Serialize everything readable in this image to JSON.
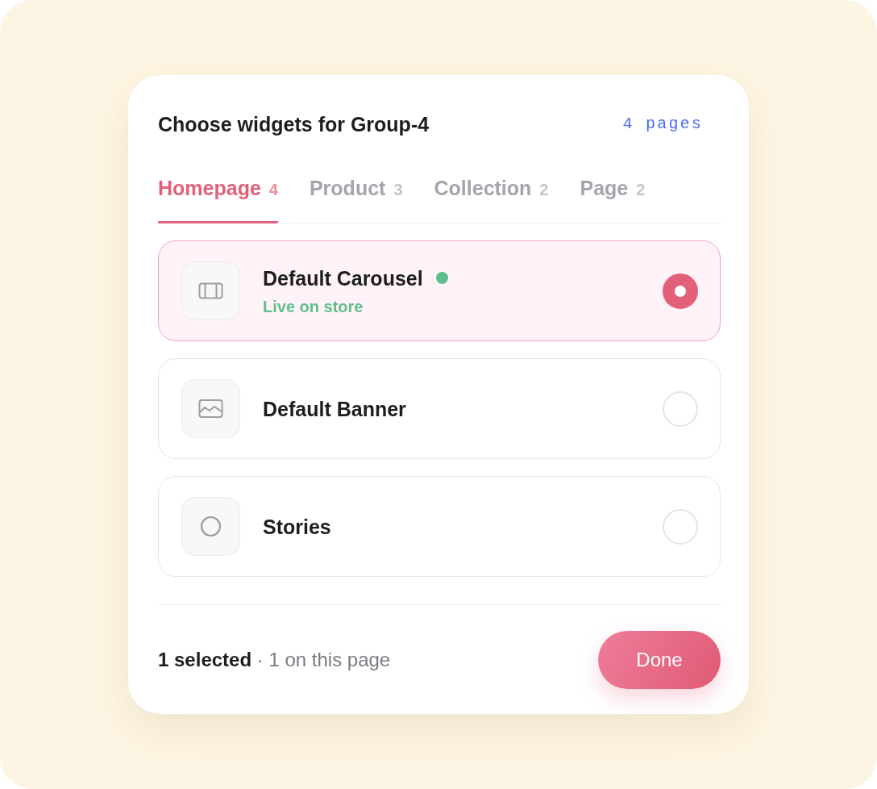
{
  "dialog": {
    "title": "Choose widgets for Group-4",
    "page_count": "4 pages"
  },
  "tabs": [
    {
      "label": "Homepage",
      "count": "4",
      "selected": true
    },
    {
      "label": "Product",
      "count": "3",
      "selected": false
    },
    {
      "label": "Collection",
      "count": "2",
      "selected": false
    },
    {
      "label": "Page",
      "count": "2",
      "selected": false
    }
  ],
  "widgets": [
    {
      "kind": "carousel",
      "name": "Default Carousel",
      "live": true,
      "status": "Live on store",
      "selected": true
    },
    {
      "kind": "banner",
      "name": "Default Banner",
      "live": false,
      "selected": false
    },
    {
      "kind": "stories",
      "name": "Stories",
      "live": false,
      "selected": false
    }
  ],
  "footer": {
    "summary": "**1 selected** · 1 on this page",
    "done_button": "Done"
  }
}
